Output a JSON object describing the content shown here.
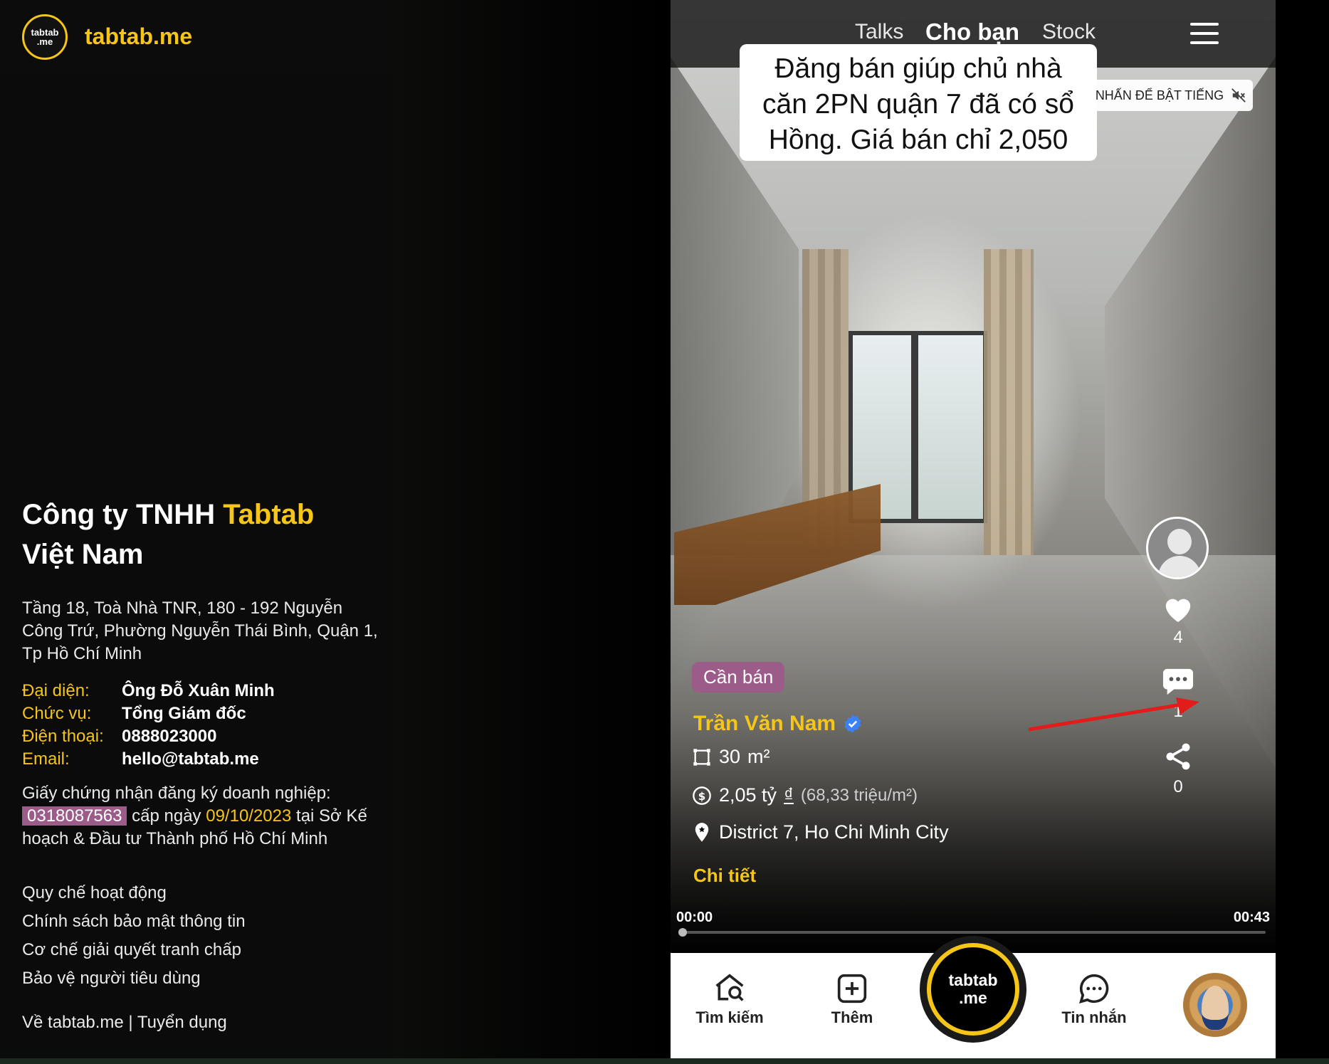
{
  "brand": {
    "logo_line1": "tabtab",
    "logo_line2": ".me",
    "name": "tabtab.me"
  },
  "company": {
    "name_part1": "Công ty TNHH ",
    "name_highlight": "Tabtab",
    "name_part2": "Việt Nam",
    "address": "Tầng 18, Toà Nhà TNR, 180 - 192 Nguyễn Công Trứ, Phường Nguyễn Thái Bình, Quận 1, Tp Hồ Chí Minh",
    "rep_label": "Đại diện:",
    "rep_value": "Ông Đỗ Xuân Minh",
    "title_label": "Chức vụ:",
    "title_value": "Tổng Giám đốc",
    "phone_label": "Điện thoại:",
    "phone_value": "0888023000",
    "email_label": "Email:",
    "email_value": "hello@tabtab.me",
    "license_intro": "Giấy chứng nhận đăng ký doanh nghiệp:",
    "license_number": "0318087563",
    "license_mid": " cấp ngày ",
    "license_date": "09/10/2023",
    "license_end": " tại Sở Kế hoạch & Đầu tư Thành phố Hồ Chí Minh"
  },
  "policy_links": [
    "Quy chế hoạt động",
    "Chính sách bảo mật thông tin",
    "Cơ chế giải quyết tranh chấp",
    "Bảo vệ người tiêu dùng"
  ],
  "footer": {
    "about": "Về tabtab.me",
    "separator": " | ",
    "careers": "Tuyển dụng"
  },
  "topnav": {
    "tab1": "Talks",
    "tab2": "Cho bạn",
    "tab3": "Stock"
  },
  "video": {
    "caption_line1": "Đăng bán giúp chủ nhà",
    "caption_line2": "căn 2PN quận 7 đã có sổ",
    "caption_line3": "Hồng. Giá bán chỉ 2,050",
    "sound_label": "NHẤN ĐỂ BẬT TIẾNG",
    "time_start": "00:00",
    "time_end": "00:43",
    "progress": 0
  },
  "listing": {
    "badge": "Cần bán",
    "poster": "Trần Văn Nam",
    "area": "30",
    "area_unit": "m²",
    "price": "2,05 tỷ",
    "currency": "₫",
    "price_per_m2": "(68,33 triệu/m²)",
    "location": "District 7, Ho Chi Minh City",
    "detail_link": "Chi tiết"
  },
  "actions": {
    "likes": "4",
    "comments": "1",
    "shares": "0"
  },
  "bottom_nav": {
    "search": "Tìm kiếm",
    "add": "Thêm",
    "center_line1": "tabtab",
    "center_line2": ".me",
    "messages": "Tin nhắn"
  },
  "colors": {
    "accent": "#f5c518",
    "badge": "#9c5c8a",
    "verified": "#3b82f6",
    "arrow": "#e21b1b"
  }
}
